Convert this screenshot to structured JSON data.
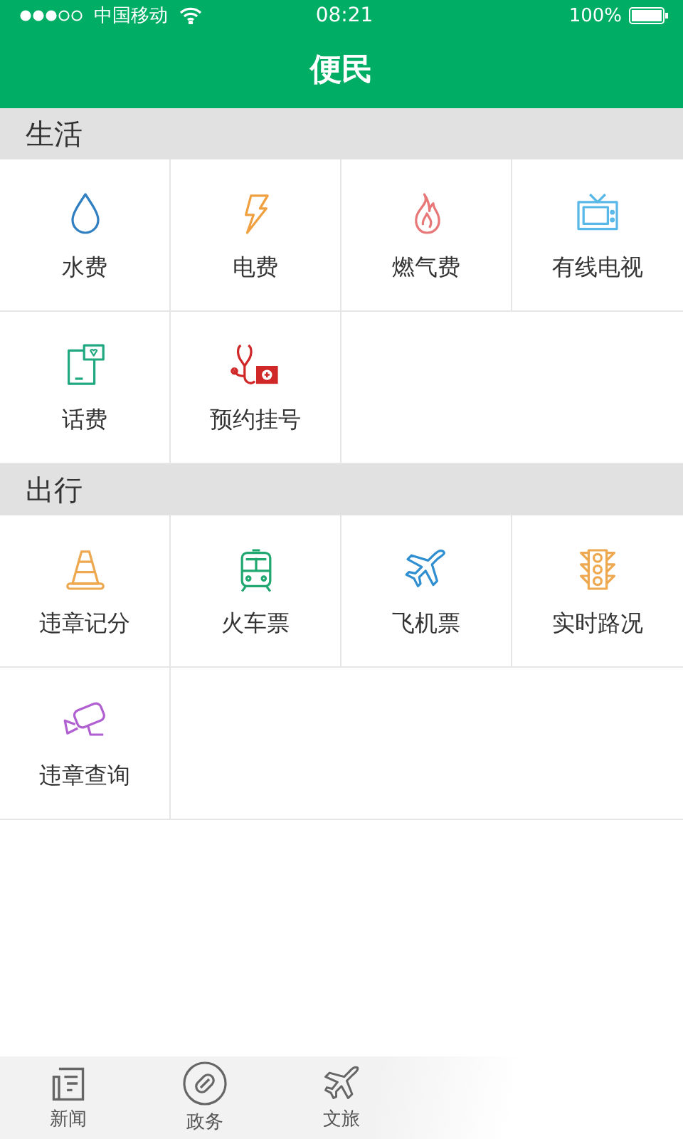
{
  "status_bar": {
    "carrier": "中国移动",
    "time": "08:21",
    "battery": "100%"
  },
  "header": {
    "title": "便民"
  },
  "sections": [
    {
      "title": "生活",
      "items": [
        {
          "label": "水费",
          "kind": "drop"
        },
        {
          "label": "电费",
          "kind": "bolt"
        },
        {
          "label": "燃气费",
          "kind": "flame"
        },
        {
          "label": "有线电视",
          "kind": "tv"
        },
        {
          "label": "话费",
          "kind": "phone"
        },
        {
          "label": "预约挂号",
          "kind": "stethoscope"
        }
      ]
    },
    {
      "title": "出行",
      "items": [
        {
          "label": "违章记分",
          "kind": "cone"
        },
        {
          "label": "火车票",
          "kind": "train"
        },
        {
          "label": "飞机票",
          "kind": "plane"
        },
        {
          "label": "实时路况",
          "kind": "traffic"
        },
        {
          "label": "违章查询",
          "kind": "camera"
        }
      ]
    }
  ],
  "tab_bar": [
    {
      "label": "新闻",
      "kind": "news"
    },
    {
      "label": "政务",
      "kind": "link"
    },
    {
      "label": "文旅",
      "kind": "plane"
    }
  ]
}
